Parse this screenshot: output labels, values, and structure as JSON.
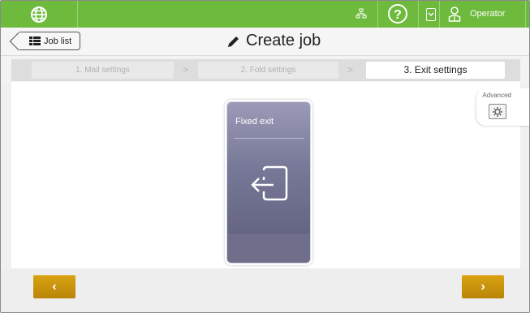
{
  "topbar": {
    "user_label": "Operator",
    "help_label": "?",
    "icons": [
      "globe-icon",
      "network-icon",
      "help-icon",
      "chevron-down-icon",
      "user-icon"
    ],
    "accent": "#6dba3c"
  },
  "header": {
    "back_label": "Job list",
    "title": "Create job"
  },
  "steps": [
    {
      "label": "1. Mail settings"
    },
    {
      "label": "2. Fold settings"
    },
    {
      "label": "3. Exit settings"
    }
  ],
  "advanced": {
    "label": "Advanced"
  },
  "exit_option": {
    "label": "Fixed exit",
    "color": "#787898"
  },
  "footer": {
    "prev_label": "‹",
    "next_label": "›",
    "button_color": "#c9940c"
  }
}
